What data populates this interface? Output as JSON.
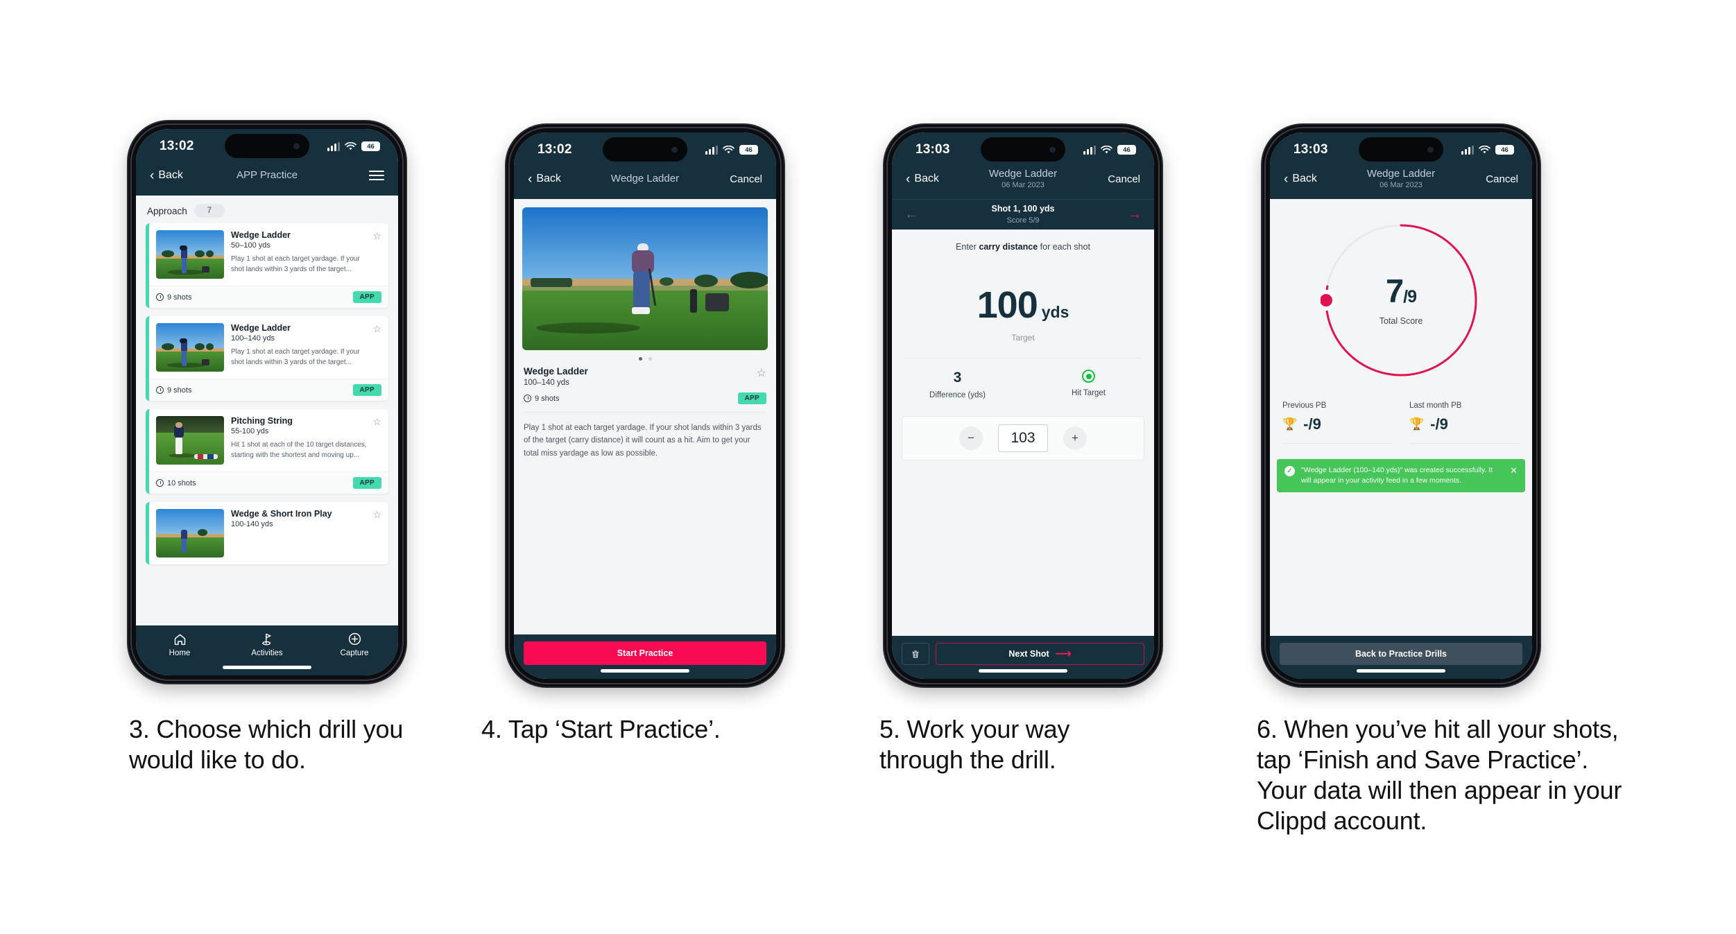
{
  "page": {
    "background": "#ffffff",
    "accent_pink": "#f90b54",
    "accent_teal": "#45d9b0",
    "header_navy": "#16303e",
    "toast_green": "#46c659"
  },
  "phones": [
    {
      "id": "phone-1",
      "status": {
        "time": "13:02",
        "battery": "46"
      },
      "nav": {
        "back": "Back",
        "title": "APP Practice",
        "menu_icon": "hamburger-menu-icon"
      },
      "section": {
        "label": "Approach",
        "count": "7"
      },
      "cards": [
        {
          "title": "Wedge Ladder",
          "yardage": "50–100 yds",
          "desc": "Play 1 shot at each target yardage. If your shot lands within 3 yards of the target...",
          "shots": "9 shots",
          "tag": "APP"
        },
        {
          "title": "Wedge Ladder",
          "yardage": "100–140 yds",
          "desc": "Play 1 shot at each target yardage. If your shot lands within 3 yards of the target...",
          "shots": "9 shots",
          "tag": "APP"
        },
        {
          "title": "Pitching String",
          "yardage": "55-100 yds",
          "desc": "Hit 1 shot at each of the 10 target distances, starting with the shortest and moving up...",
          "shots": "10 shots",
          "tag": "APP"
        },
        {
          "title": "Wedge & Short Iron Play",
          "yardage": "100-140 yds",
          "desc": "",
          "shots": "",
          "tag": ""
        }
      ],
      "tabs": [
        {
          "label": "Home",
          "icon": "home-icon"
        },
        {
          "label": "Activities",
          "icon": "golf-flag-icon"
        },
        {
          "label": "Capture",
          "icon": "plus-circle-icon"
        }
      ]
    },
    {
      "id": "phone-2",
      "status": {
        "time": "13:02",
        "battery": "46"
      },
      "nav": {
        "back": "Back",
        "title": "Wedge Ladder",
        "cancel": "Cancel"
      },
      "detail": {
        "title": "Wedge Ladder",
        "yardage": "100–140 yds",
        "shots": "9 shots",
        "tag": "APP",
        "description": "Play 1 shot at each target yardage. If your shot lands within 3 yards of the target (carry distance) it will count as a hit. Aim to get your total miss yardage as low as possible."
      },
      "cta": "Start Practice"
    },
    {
      "id": "phone-3",
      "status": {
        "time": "13:03",
        "battery": "46"
      },
      "nav": {
        "back": "Back",
        "title": "Wedge Ladder",
        "subtitle": "06 Mar 2023",
        "cancel": "Cancel"
      },
      "shotbar": {
        "title": "Shot 1, 100 yds",
        "score": "Score 5/9"
      },
      "prompt_prefix": "Enter ",
      "prompt_bold": "carry distance",
      "prompt_suffix": " for each shot",
      "target": {
        "value": "100",
        "unit": "yds",
        "caption": "Target"
      },
      "stats": [
        {
          "value": "3",
          "label": "Difference (yds)"
        },
        {
          "value": "",
          "label": "Hit Target",
          "icon": "radio-checked-icon"
        }
      ],
      "stepper": {
        "minus": "−",
        "value": "103",
        "plus": "+"
      },
      "footer": {
        "delete_icon": "trash-icon",
        "next": "Next Shot"
      }
    },
    {
      "id": "phone-4",
      "status": {
        "time": "13:03",
        "battery": "46"
      },
      "nav": {
        "back": "Back",
        "title": "Wedge Ladder",
        "subtitle": "06 Mar 2023",
        "cancel": "Cancel"
      },
      "ring": {
        "numerator": "7",
        "separator": "/",
        "denominator": "9",
        "caption": "Total Score",
        "progress_fraction": 0.78
      },
      "pbs": [
        {
          "label": "Previous PB",
          "value": "-/9",
          "icon": "trophy-icon"
        },
        {
          "label": "Last month PB",
          "value": "-/9",
          "icon": "trophy-icon"
        }
      ],
      "toast": {
        "icon": "check-circle-icon",
        "message": "\"Wedge Ladder (100–140 yds)\" was created successfully. It will appear in your activity feed in a few moments.",
        "close_icon": "close-icon"
      },
      "footer": {
        "back_button": "Back to Practice Drills"
      }
    }
  ],
  "captions": [
    "3. Choose which drill you would like to do.",
    "4. Tap ‘Start Practice’.",
    "5. Work your way through the drill.",
    "6. When you’ve hit all your shots, tap ‘Finish and Save Practice’. Your data will then appear in your Clippd account."
  ]
}
